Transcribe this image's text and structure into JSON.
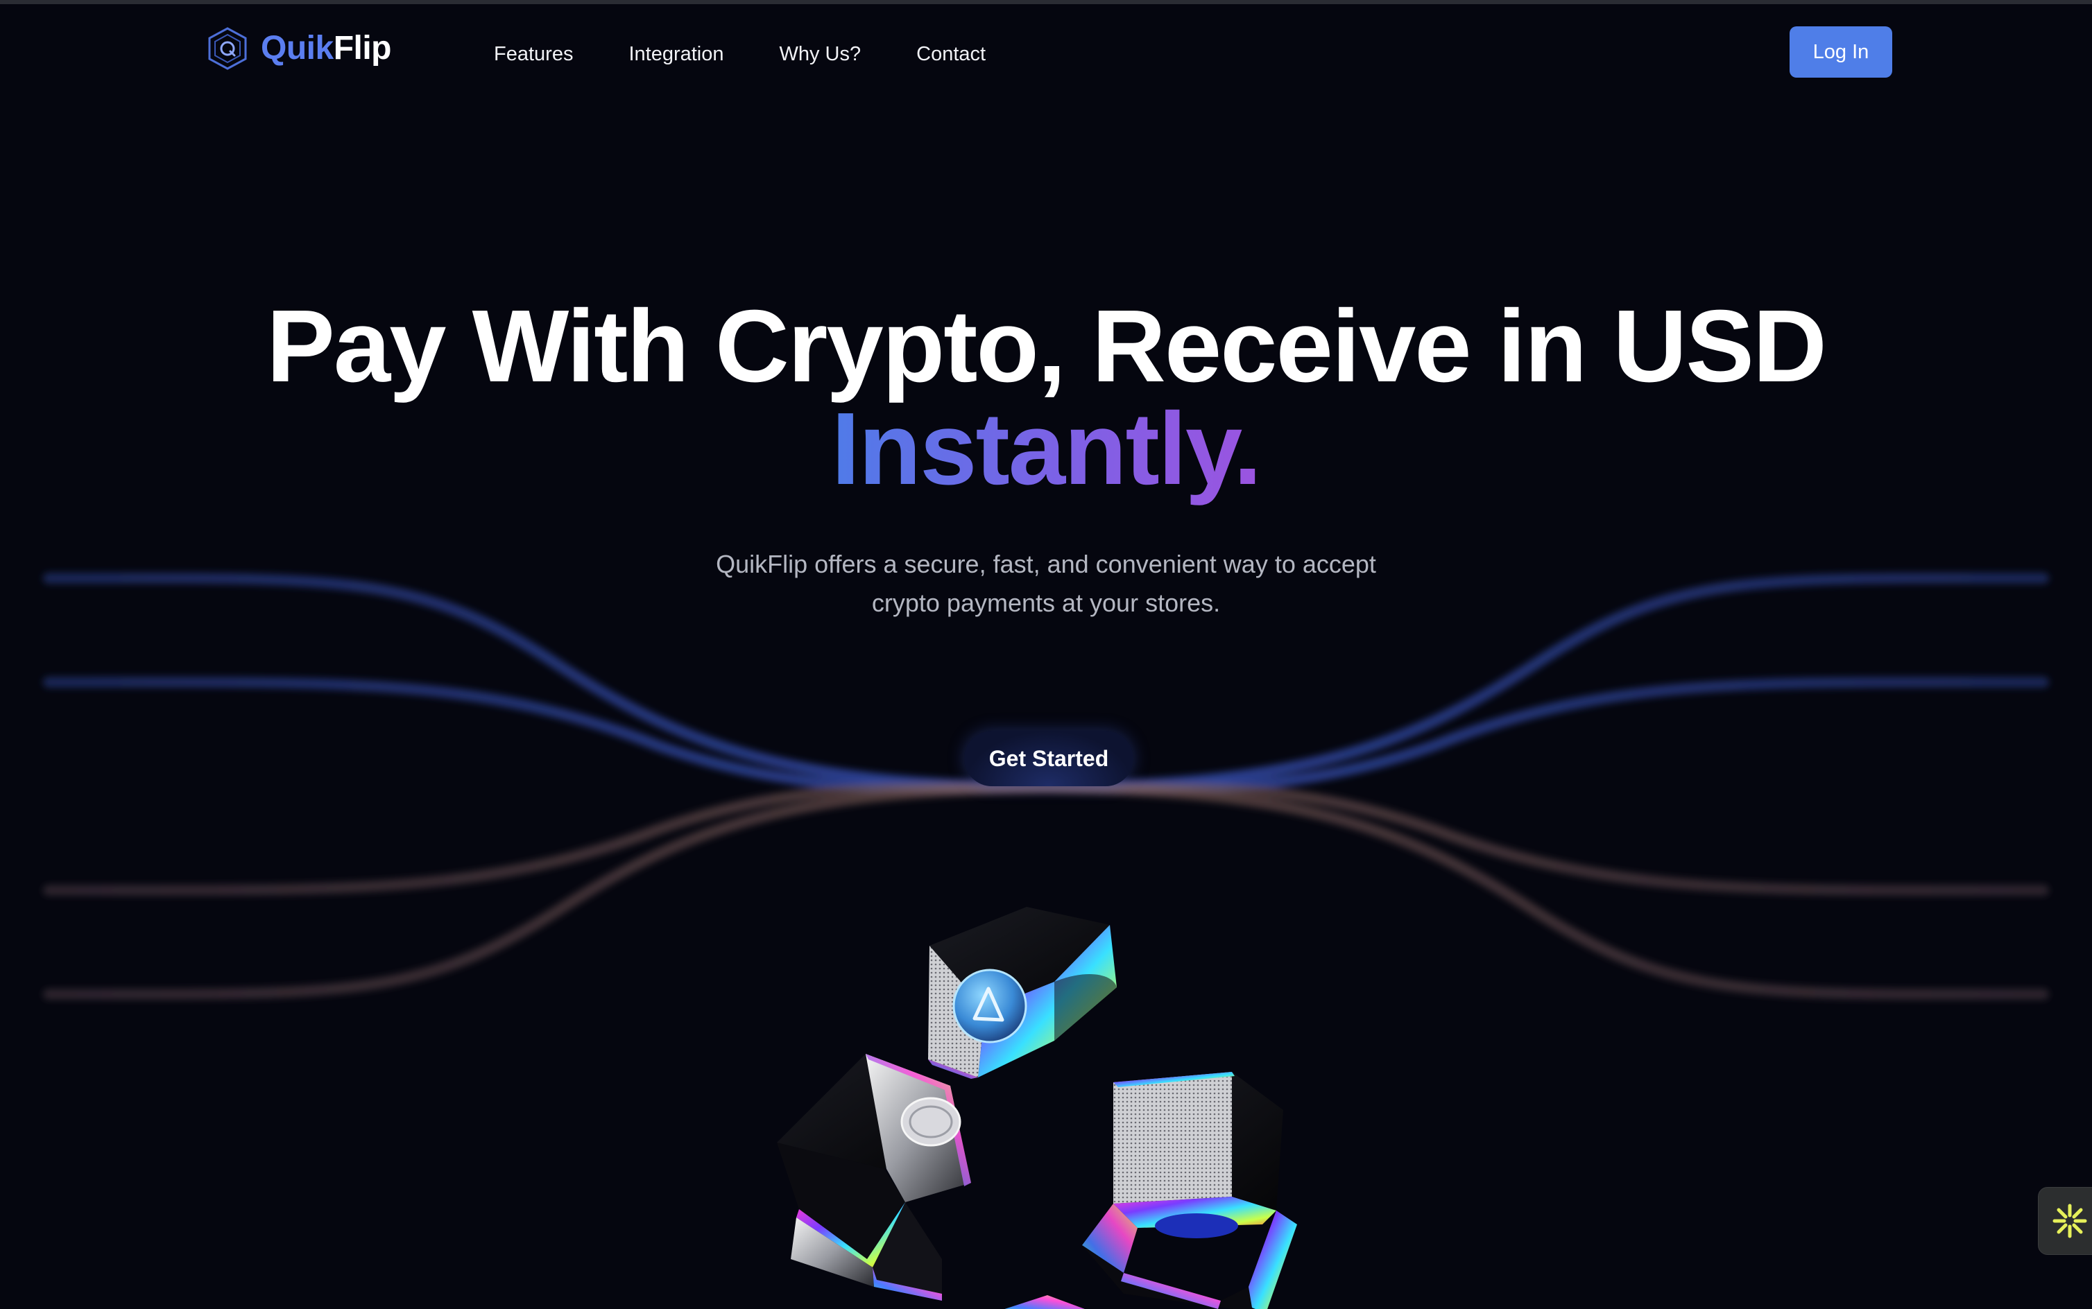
{
  "brand": {
    "name_part1": "Quik",
    "name_part2": "Flip",
    "logo_icon": "hexagon-q-icon",
    "accent_color": "#5b7ef0"
  },
  "nav": {
    "links": [
      {
        "label": "Features"
      },
      {
        "label": "Integration"
      },
      {
        "label": "Why Us?"
      },
      {
        "label": "Contact"
      }
    ],
    "login_label": "Log In",
    "login_color": "#4f7ee8"
  },
  "hero": {
    "title": "Pay With Crypto, Receive in USD",
    "title_accent": "Instantly.",
    "accent_gradient": [
      "#4f7be8",
      "#7a63e6",
      "#9b54e0"
    ],
    "subtitle_line1": "QuikFlip offers a secure, fast, and convenient way to accept",
    "subtitle_line2": "crypto payments at your stores.",
    "cta_label": "Get Started"
  },
  "widget": {
    "icon": "asterisk-burst-icon",
    "color": "#e6f05a"
  },
  "colors": {
    "background": "#05060f",
    "text": "#ffffff",
    "muted_text": "#b4b7c2"
  }
}
